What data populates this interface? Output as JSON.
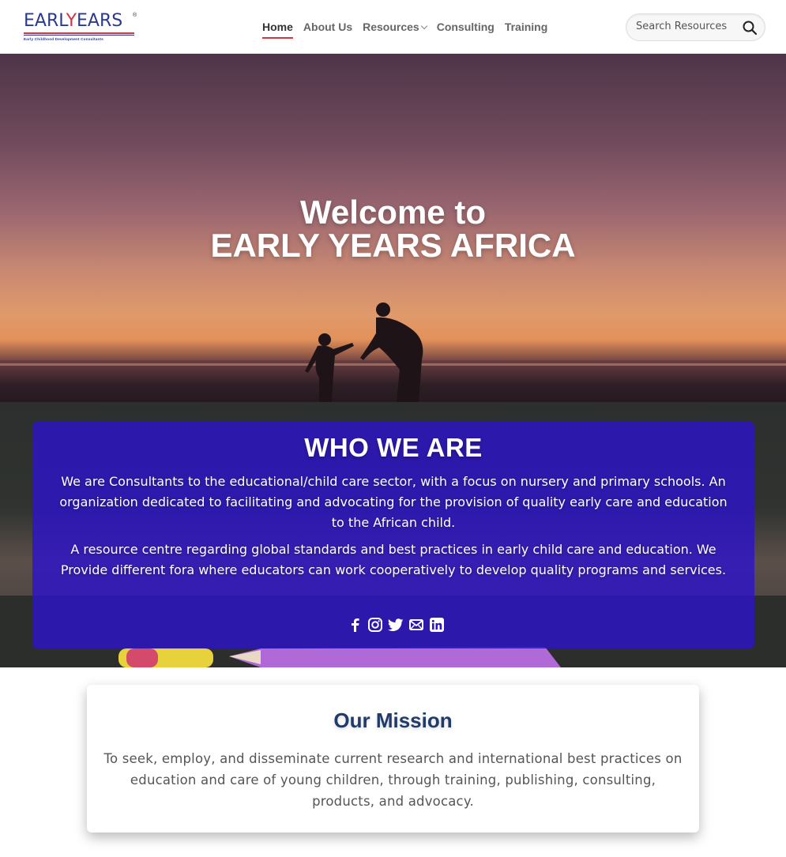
{
  "header": {
    "logo": {
      "word_part1": "EARL",
      "word_y": "Y",
      "word_gap": " ",
      "word_part2": "EARS",
      "registered": "®",
      "tagline": "Early Childhood Development Consultants"
    },
    "nav": [
      {
        "label": "Home",
        "active": true
      },
      {
        "label": "About Us",
        "active": false
      },
      {
        "label": "Resources",
        "active": false,
        "has_dropdown": true
      },
      {
        "label": "Consulting",
        "active": false
      },
      {
        "label": "Training",
        "active": false
      }
    ],
    "search": {
      "placeholder": "Search Resources",
      "icon": "search-icon"
    }
  },
  "hero": {
    "line1": "Welcome to",
    "line2": "EARLY YEARS AFRICA"
  },
  "who": {
    "title": "WHO WE ARE",
    "paragraph1": "We are Consultants to the educational/child care sector, with a focus on nursery and primary schools. An organization dedicated to facilitating and advocating for the provision of quality early care and education to the African child.",
    "paragraph2": "A resource centre regarding global standards and best practices in early child care and education. We Provide different fora where educators can work cooperatively to develop quality programs and services.",
    "socials": [
      "facebook-icon",
      "instagram-icon",
      "twitter-icon",
      "email-icon",
      "linkedin-icon"
    ]
  },
  "mission": {
    "title": "Our Mission",
    "text": "To seek, employ, and disseminate current research and international best practices on education and care of young children, through training, publishing, consulting, products, and advocacy."
  },
  "colors": {
    "brand_blue": "#2a3b8f",
    "brand_red": "#d9333f",
    "who_card": "#2d14c8",
    "mission_title": "#1f3a6b"
  }
}
